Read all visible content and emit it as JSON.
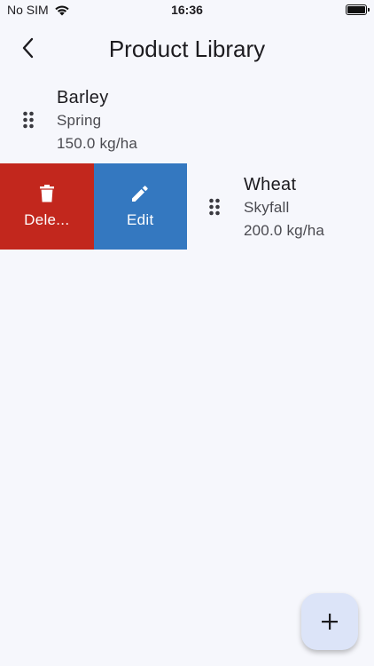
{
  "status_bar": {
    "carrier": "No SIM",
    "time": "16:36",
    "icons": [
      "wifi-icon",
      "battery-icon"
    ]
  },
  "app_bar": {
    "title": "Product Library",
    "back_icon": "chevron-left-icon"
  },
  "products": [
    {
      "name": "Barley",
      "variety": "Spring",
      "rate": "150.0 kg/ha"
    },
    {
      "name": "Wheat",
      "variety": "Skyfall",
      "rate": "200.0 kg/ha"
    }
  ],
  "slide_actions": {
    "delete_label": "Dele...",
    "delete_icon": "trash-icon",
    "delete_color": "#c2271d",
    "edit_label": "Edit",
    "edit_icon": "pencil-icon",
    "edit_color": "#3478c0"
  },
  "fab": {
    "icon": "plus-icon",
    "background": "#dce4f8"
  }
}
